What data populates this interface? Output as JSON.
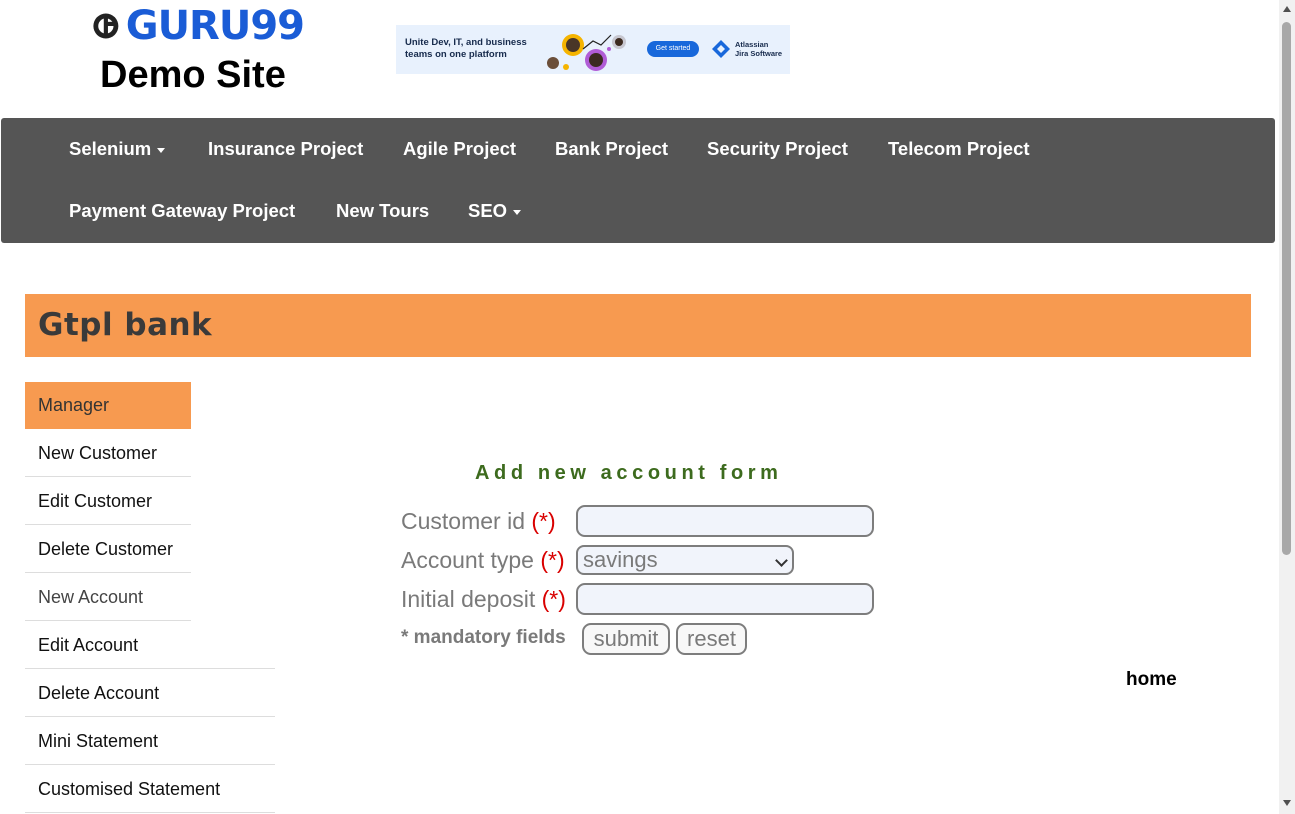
{
  "header": {
    "logo_text": "GURU99",
    "site_title": "Demo Site",
    "ad": {
      "headline": "Unite Dev, IT, and business teams on one platform",
      "button": "Get started",
      "brand_line1": "Atlassian",
      "brand_line2": "Jira Software",
      "brand_color": "#1868db"
    }
  },
  "nav": {
    "row1": [
      "Selenium",
      "Insurance Project",
      "Agile Project",
      "Bank Project",
      "Security Project",
      "Telecom Project"
    ],
    "row2": [
      "Payment Gateway Project",
      "New Tours",
      "SEO"
    ],
    "bg_color": "#555555"
  },
  "bank": {
    "title": "Gtpl bank",
    "accent_color": "#f79a50"
  },
  "sidebar": {
    "items": [
      {
        "label": "Manager"
      },
      {
        "label": "New Customer"
      },
      {
        "label": "Edit Customer"
      },
      {
        "label": "Delete Customer"
      },
      {
        "label": "New Account"
      },
      {
        "label": "Edit Account"
      },
      {
        "label": "Delete Account"
      },
      {
        "label": "Mini Statement"
      },
      {
        "label": "Customised Statement"
      }
    ]
  },
  "form": {
    "title": "Add new account form",
    "customer_id_label": "Customer id",
    "account_type_label": "Account type",
    "initial_deposit_label": "Initial deposit",
    "required_marker": "(*)",
    "customer_id_value": "",
    "initial_deposit_value": "",
    "account_type_selected": "savings",
    "mandatory_note": "* mandatory fields",
    "submit_label": "submit",
    "reset_label": "reset"
  },
  "footer": {
    "home_link": "home"
  }
}
